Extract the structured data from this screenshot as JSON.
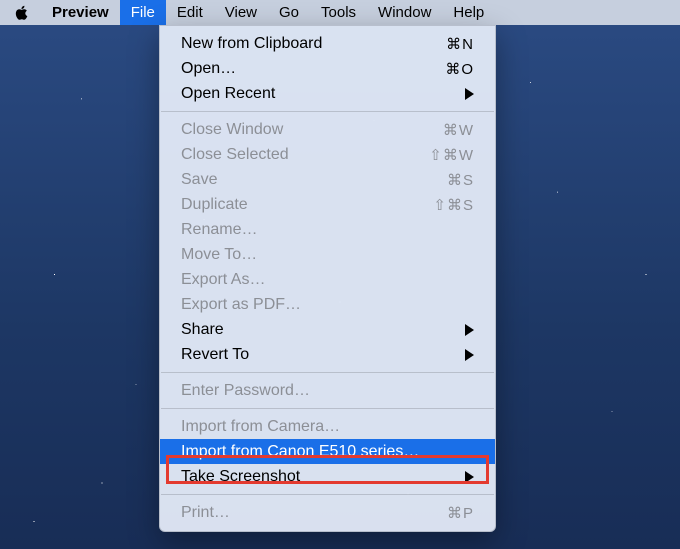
{
  "menubar": {
    "app": "Preview",
    "file": "File",
    "edit": "Edit",
    "view": "View",
    "go": "Go",
    "tools": "Tools",
    "window": "Window",
    "help": "Help"
  },
  "menu": {
    "new_from_clipboard": {
      "label": "New from Clipboard",
      "sc": "⌘N"
    },
    "open": {
      "label": "Open…",
      "sc": "⌘O"
    },
    "open_recent": {
      "label": "Open Recent"
    },
    "close_window": {
      "label": "Close Window",
      "sc": "⌘W"
    },
    "close_selected": {
      "label": "Close Selected",
      "sc": "⇧⌘W"
    },
    "save": {
      "label": "Save",
      "sc": "⌘S"
    },
    "duplicate": {
      "label": "Duplicate",
      "sc": "⇧⌘S"
    },
    "rename": {
      "label": "Rename…"
    },
    "move_to": {
      "label": "Move To…"
    },
    "export_as": {
      "label": "Export As…"
    },
    "export_as_pdf": {
      "label": "Export as PDF…"
    },
    "share": {
      "label": "Share"
    },
    "revert_to": {
      "label": "Revert To"
    },
    "enter_password": {
      "label": "Enter Password…"
    },
    "import_from_camera": {
      "label": "Import from Camera…"
    },
    "import_from_scanner": {
      "label": "Import from Canon E510 series…"
    },
    "take_screenshot": {
      "label": "Take Screenshot"
    },
    "print": {
      "label": "Print…",
      "sc": "⌘P"
    }
  }
}
